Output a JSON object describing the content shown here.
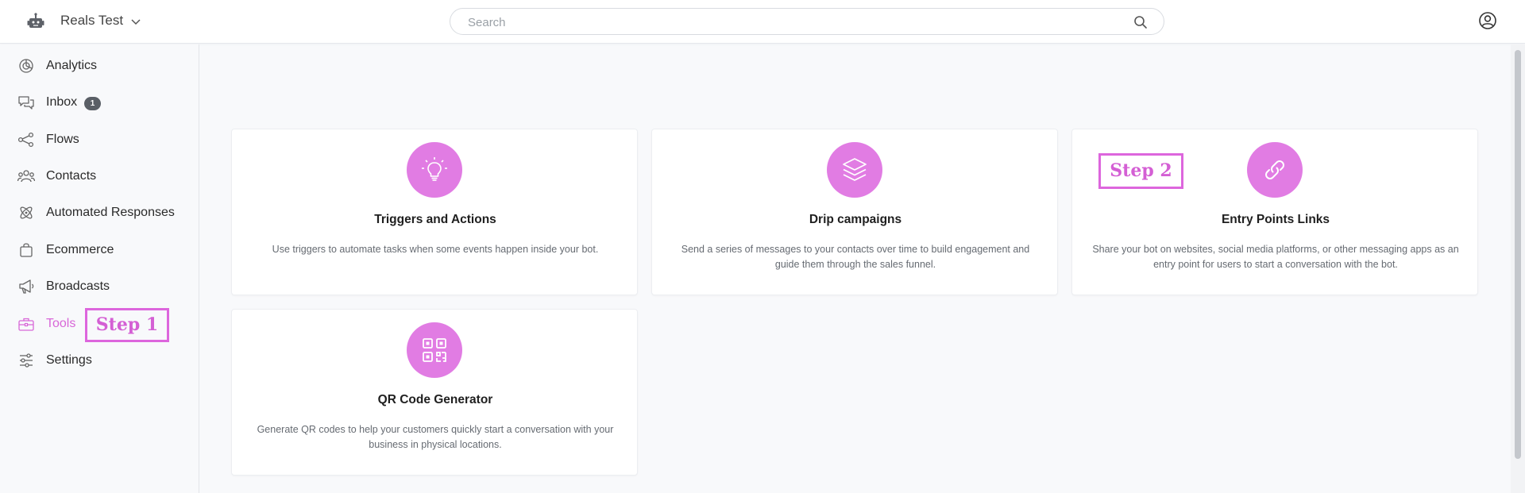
{
  "header": {
    "workspace_name": "Reals Test",
    "search_placeholder": "Search",
    "bot_icon": "robot-icon",
    "user_icon": "user-circle-icon"
  },
  "sidebar": {
    "items": [
      {
        "label": "Analytics",
        "icon": "pie-chart-icon"
      },
      {
        "label": "Inbox",
        "icon": "chat-bubbles-icon",
        "badge": "1"
      },
      {
        "label": "Flows",
        "icon": "flows-icon"
      },
      {
        "label": "Contacts",
        "icon": "contacts-icon"
      },
      {
        "label": "Automated Responses",
        "icon": "atom-icon"
      },
      {
        "label": "Ecommerce",
        "icon": "shopping-bag-icon"
      },
      {
        "label": "Broadcasts",
        "icon": "megaphone-icon"
      },
      {
        "label": "Tools",
        "icon": "toolbox-icon",
        "active": true
      },
      {
        "label": "Settings",
        "icon": "sliders-icon"
      }
    ]
  },
  "annotations": {
    "step1": "Step 1",
    "step2": "Step 2"
  },
  "cards": [
    {
      "title": "Triggers and Actions",
      "description": "Use triggers to automate tasks when some events happen inside your bot.",
      "icon": "lightbulb-icon"
    },
    {
      "title": "Drip campaigns",
      "description": "Send a series of messages to your contacts over time to build engagement and guide them through the sales funnel.",
      "icon": "layers-icon"
    },
    {
      "title": "Entry Points Links",
      "description": "Share your bot on websites, social media platforms, or other messaging apps as an entry point for users to start a conversation with the bot.",
      "icon": "link-icon"
    },
    {
      "title": "QR Code Generator",
      "description": "Generate QR codes to help your customers quickly start a conversation with your business in physical locations.",
      "icon": "qr-code-icon"
    }
  ],
  "colors": {
    "accent": "#e17ce3",
    "active_nav": "#d867d8",
    "annotation": "#dd66dd"
  }
}
